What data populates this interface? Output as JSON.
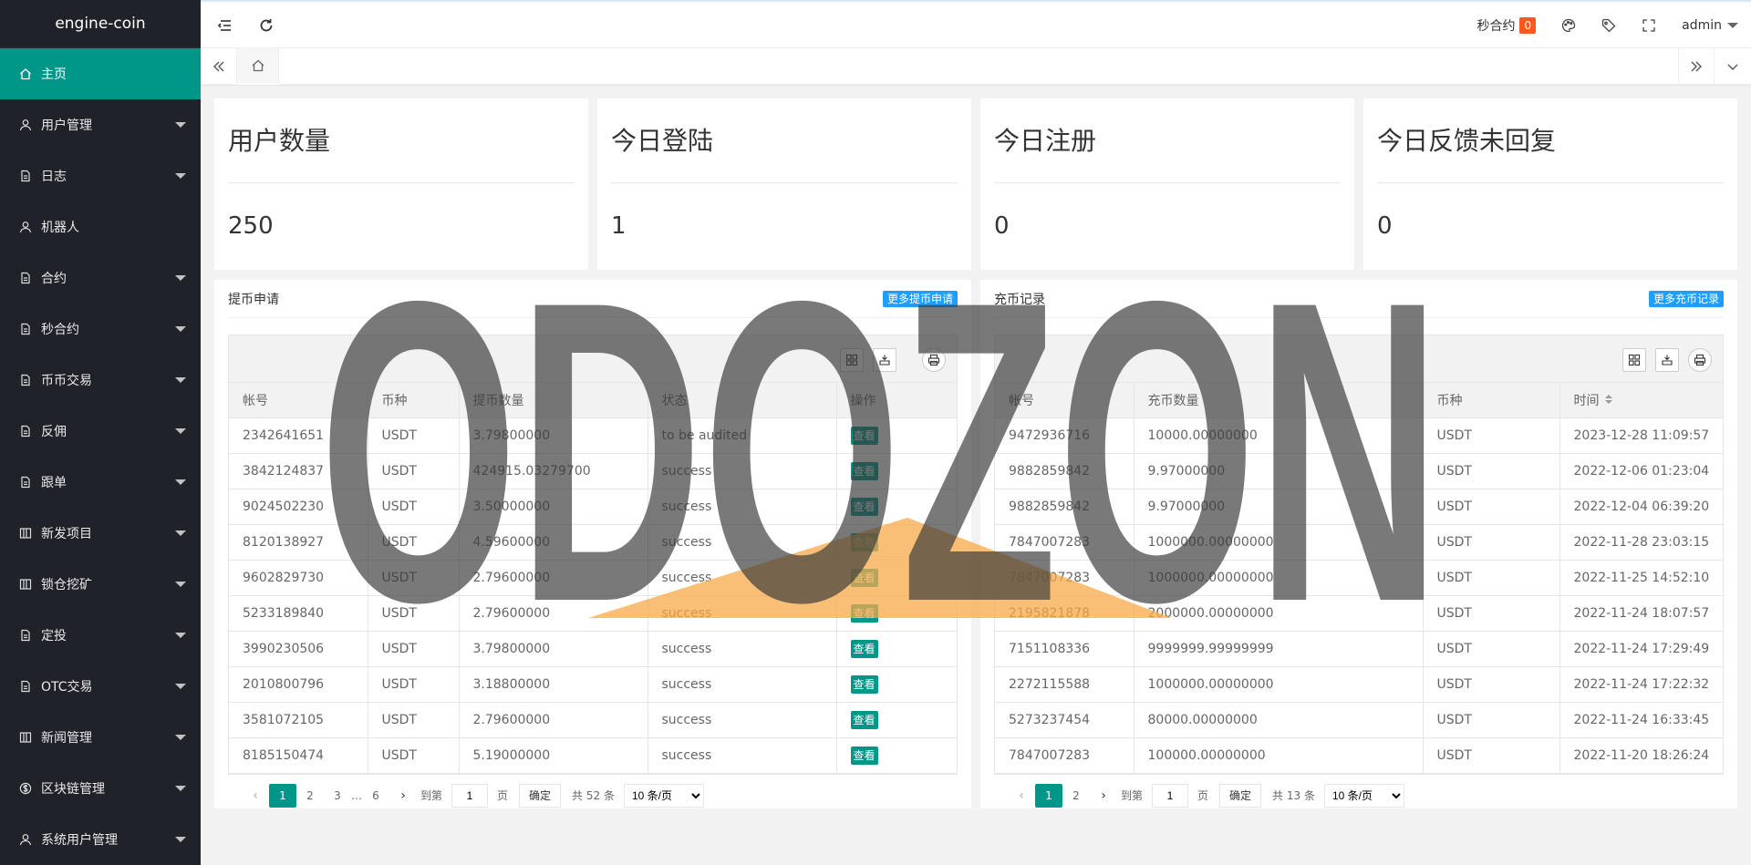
{
  "app": {
    "title": "engine-coin"
  },
  "sidebar": {
    "items": [
      {
        "label": "主页",
        "icon": "home-icon",
        "active": true,
        "caret": false
      },
      {
        "label": "用户管理",
        "icon": "user-icon",
        "caret": true
      },
      {
        "label": "日志",
        "icon": "file-icon",
        "caret": true
      },
      {
        "label": "机器人",
        "icon": "user-icon",
        "caret": false
      },
      {
        "label": "合约",
        "icon": "file-icon",
        "caret": true
      },
      {
        "label": "秒合约",
        "icon": "file-icon",
        "caret": true
      },
      {
        "label": "币币交易",
        "icon": "file-icon",
        "caret": true
      },
      {
        "label": "反佣",
        "icon": "file-icon",
        "caret": true
      },
      {
        "label": "跟单",
        "icon": "file-icon",
        "caret": true
      },
      {
        "label": "新发项目",
        "icon": "app-icon",
        "caret": true
      },
      {
        "label": "锁仓挖矿",
        "icon": "app-icon",
        "caret": true
      },
      {
        "label": "定投",
        "icon": "file-icon",
        "caret": true
      },
      {
        "label": "OTC交易",
        "icon": "file-icon",
        "caret": true
      },
      {
        "label": "新闻管理",
        "icon": "app-icon",
        "caret": true
      },
      {
        "label": "区块链管理",
        "icon": "dollar-icon",
        "caret": true
      },
      {
        "label": "系统用户管理",
        "icon": "user-icon",
        "caret": true
      }
    ]
  },
  "topbar": {
    "contract_label": "秒合约",
    "contract_badge": "0",
    "admin_label": "admin"
  },
  "cards": [
    {
      "title": "用户数量",
      "value": "250"
    },
    {
      "title": "今日登陆",
      "value": "1"
    },
    {
      "title": "今日注册",
      "value": "0"
    },
    {
      "title": "今日反馈未回复",
      "value": "0"
    }
  ],
  "withdraw": {
    "title": "提币申请",
    "more_label": "更多提币申请",
    "columns": [
      "帐号",
      "币种",
      "提币数量",
      "状态",
      "操作"
    ],
    "rows": [
      [
        "2342641651",
        "USDT",
        "3.79800000",
        "to be audited",
        "查看"
      ],
      [
        "3842124837",
        "USDT",
        "424915.03279700",
        "success",
        "查看"
      ],
      [
        "9024502230",
        "USDT",
        "3.50000000",
        "success",
        "查看"
      ],
      [
        "8120138927",
        "USDT",
        "4.59600000",
        "success",
        "查看"
      ],
      [
        "9602829730",
        "USDT",
        "2.79600000",
        "success",
        "查看"
      ],
      [
        "5233189840",
        "USDT",
        "2.79600000",
        "success",
        "查看"
      ],
      [
        "3990230506",
        "USDT",
        "3.79800000",
        "success",
        "查看"
      ],
      [
        "2010800796",
        "USDT",
        "3.18800000",
        "success",
        "查看"
      ],
      [
        "3581072105",
        "USDT",
        "2.79600000",
        "success",
        "查看"
      ],
      [
        "8185150474",
        "USDT",
        "5.19000000",
        "success",
        "查看"
      ]
    ],
    "pager": {
      "pages": [
        "1",
        "2",
        "3",
        "…",
        "6"
      ],
      "goto_label": "到第",
      "goto_value": "1",
      "page_unit": "页",
      "confirm": "确定",
      "total": "共 52 条",
      "per_page": "10 条/页"
    }
  },
  "recharge": {
    "title": "充币记录",
    "more_label": "更多充币记录",
    "columns": [
      "帐号",
      "充币数量",
      "币种",
      "时间"
    ],
    "rows": [
      [
        "9472936716",
        "10000.00000000",
        "USDT",
        "2023-12-28 11:09:57"
      ],
      [
        "9882859842",
        "9.97000000",
        "USDT",
        "2022-12-06 01:23:04"
      ],
      [
        "9882859842",
        "9.97000000",
        "USDT",
        "2022-12-04 06:39:20"
      ],
      [
        "7847007283",
        "1000000.00000000",
        "USDT",
        "2022-11-28 23:03:15"
      ],
      [
        "7847007283",
        "1000000.00000000",
        "USDT",
        "2022-11-25 14:52:10"
      ],
      [
        "2195821878",
        "2000000.00000000",
        "USDT",
        "2022-11-24 18:07:57"
      ],
      [
        "7151108336",
        "9999999.99999999",
        "USDT",
        "2022-11-24 17:29:49"
      ],
      [
        "2272115588",
        "1000000.00000000",
        "USDT",
        "2022-11-24 17:22:32"
      ],
      [
        "5273237454",
        "80000.00000000",
        "USDT",
        "2022-11-24 16:33:45"
      ],
      [
        "7847007283",
        "100000.00000000",
        "USDT",
        "2022-11-20 18:26:24"
      ]
    ],
    "pager": {
      "pages": [
        "1",
        "2"
      ],
      "goto_label": "到第",
      "goto_value": "1",
      "page_unit": "页",
      "confirm": "确定",
      "total": "共 13 条",
      "per_page": "10 条/页"
    }
  },
  "watermark": {
    "text": "ODOZON"
  },
  "colors": {
    "accent": "#009688",
    "sidebar": "#20222a",
    "badge": "#ff5722",
    "more": "#1e9fff",
    "watermark_triangle": "#f7a94a"
  }
}
